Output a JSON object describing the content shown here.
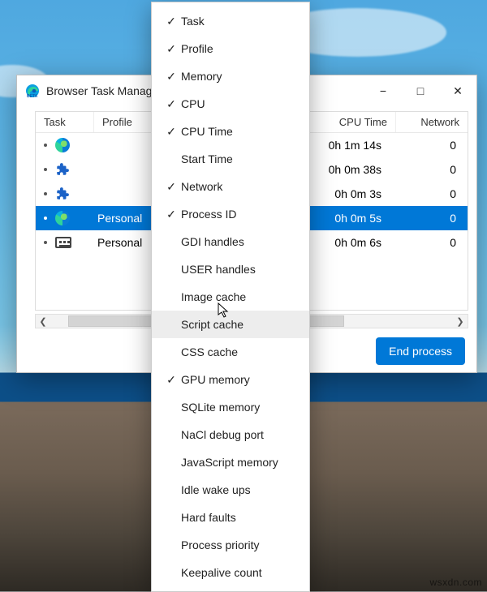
{
  "window": {
    "title": "Browser Task Manager",
    "controls": {
      "minimize": "−",
      "maximize": "□",
      "close": "✕"
    }
  },
  "columns": {
    "task": "Task",
    "profile": "Profile",
    "cpu_time": "CPU Time",
    "network": "Network"
  },
  "rows": [
    {
      "icon": "edge",
      "profile": "",
      "cpu_time": "0h 1m 14s",
      "network": "0",
      "selected": false
    },
    {
      "icon": "extension",
      "profile": "",
      "cpu_time": "0h 0m 38s",
      "network": "0",
      "selected": false
    },
    {
      "icon": "extension",
      "profile": "",
      "cpu_time": "0h 0m 3s",
      "network": "0",
      "selected": false
    },
    {
      "icon": "edge",
      "profile": "Personal",
      "cpu_time": "0h 0m 5s",
      "network": "0",
      "selected": true
    },
    {
      "icon": "keyboard",
      "profile": "Personal",
      "cpu_time": "0h 0m 6s",
      "network": "0",
      "selected": false
    }
  ],
  "end_button": "End process",
  "context_menu": {
    "hovered_index": 11,
    "items": [
      {
        "label": "Task",
        "checked": true
      },
      {
        "label": "Profile",
        "checked": true
      },
      {
        "label": "Memory",
        "checked": true
      },
      {
        "label": "CPU",
        "checked": true
      },
      {
        "label": "CPU Time",
        "checked": true
      },
      {
        "label": "Start Time",
        "checked": false
      },
      {
        "label": "Network",
        "checked": true
      },
      {
        "label": "Process ID",
        "checked": true
      },
      {
        "label": "GDI handles",
        "checked": false
      },
      {
        "label": "USER handles",
        "checked": false
      },
      {
        "label": "Image cache",
        "checked": false
      },
      {
        "label": "Script cache",
        "checked": false
      },
      {
        "label": "CSS cache",
        "checked": false
      },
      {
        "label": "GPU memory",
        "checked": true
      },
      {
        "label": "SQLite memory",
        "checked": false
      },
      {
        "label": "NaCl debug port",
        "checked": false
      },
      {
        "label": "JavaScript memory",
        "checked": false
      },
      {
        "label": "Idle wake ups",
        "checked": false
      },
      {
        "label": "Hard faults",
        "checked": false
      },
      {
        "label": "Process priority",
        "checked": false
      },
      {
        "label": "Keepalive count",
        "checked": false
      }
    ]
  },
  "watermark": "wsxdn.com"
}
